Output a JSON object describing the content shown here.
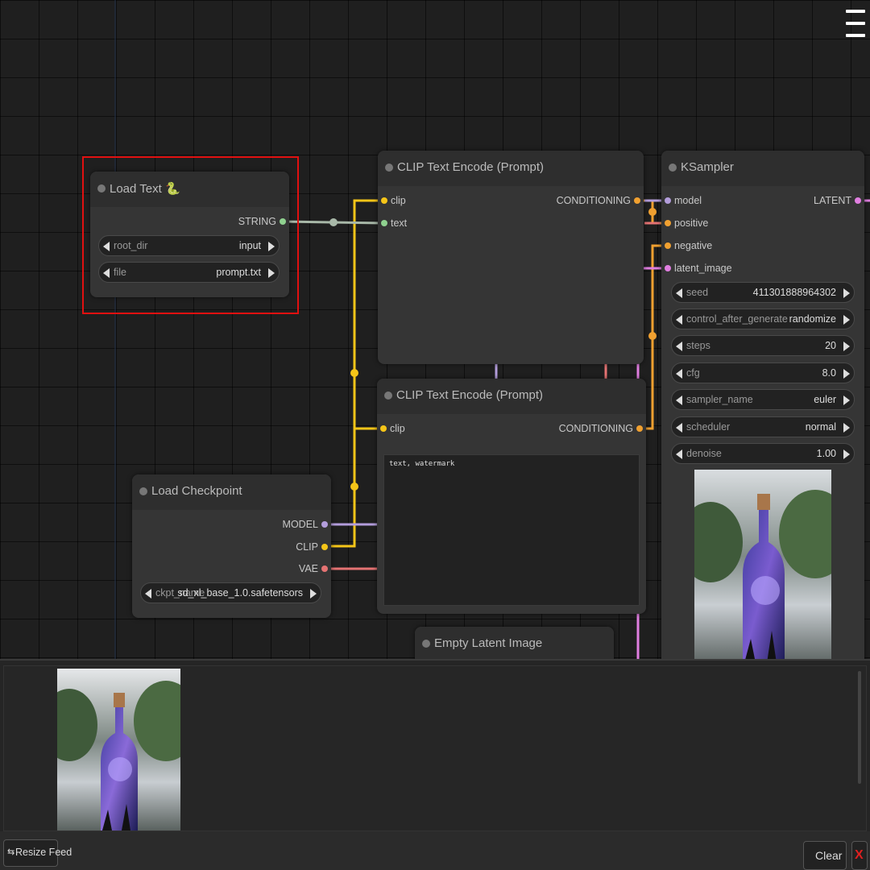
{
  "canvas": {
    "menu_icon": "hamburger-menu-icon"
  },
  "nodes": {
    "load_text": {
      "title": "Load Text 🐍",
      "output": "STRING",
      "widgets": [
        {
          "label": "root_dir",
          "value": "input"
        },
        {
          "label": "file",
          "value": "prompt.txt"
        }
      ]
    },
    "clip_pos": {
      "title": "CLIP Text Encode (Prompt)",
      "inputs": [
        "clip",
        "text"
      ],
      "output": "CONDITIONING"
    },
    "clip_neg": {
      "title": "CLIP Text Encode (Prompt)",
      "inputs": [
        "clip"
      ],
      "output": "CONDITIONING",
      "text": "text, watermark"
    },
    "ksampler": {
      "title": "KSampler",
      "inputs": [
        "model",
        "positive",
        "negative",
        "latent_image"
      ],
      "output": "LATENT",
      "widgets": [
        {
          "label": "seed",
          "value": "411301888964302"
        },
        {
          "label": "control_after_generate",
          "value": "randomize"
        },
        {
          "label": "steps",
          "value": "20"
        },
        {
          "label": "cfg",
          "value": "8.0"
        },
        {
          "label": "sampler_name",
          "value": "euler"
        },
        {
          "label": "scheduler",
          "value": "normal"
        },
        {
          "label": "denoise",
          "value": "1.00"
        }
      ]
    },
    "load_checkpoint": {
      "title": "Load Checkpoint",
      "outputs": [
        "MODEL",
        "CLIP",
        "VAE"
      ],
      "widgets": [
        {
          "label": "ckpt_name",
          "value": "sd_xl_base_1.0.safetensors"
        }
      ]
    },
    "empty_latent": {
      "title": "Empty Latent Image"
    }
  },
  "colors": {
    "clip": "#f5c518",
    "conditioning": "#f0a030",
    "model": "#b39ddb",
    "vae": "#e57373",
    "latent": "#e07ee0",
    "string": "#8fd18f",
    "selection": "#e01010"
  },
  "feed": {
    "resize_label": "Resize Feed",
    "resize_icon": "resize-arrows-icon",
    "clear_label": "Clear",
    "close_label": "X"
  }
}
